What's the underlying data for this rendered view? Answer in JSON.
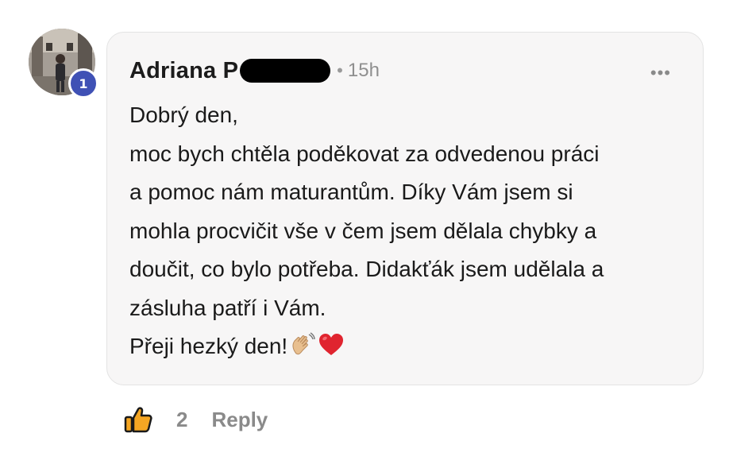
{
  "comment": {
    "author": "Adriana P",
    "separator": "•",
    "time": "15h",
    "more_label": "•••",
    "body_lines": [
      "Dobrý den,",
      "moc bych chtěla poděkovat za odvedenou práci",
      "a pomoc nám maturantům. Díky Vám jsem si",
      "mohla procvičit vše v čem jsem dělala chybky a",
      "doučit, co bylo potřeba. Didakťák jsem udělala a",
      "zásluha patří i Vám.",
      "Přeji hezký den!"
    ],
    "emojis": [
      "waving-hand-icon",
      "red-heart-icon"
    ]
  },
  "avatar": {
    "badge": "1",
    "badge_color": "#3f51b5"
  },
  "footer": {
    "like_count": "2",
    "reply_label": "Reply"
  },
  "colors": {
    "bubble_bg": "#f7f6f6",
    "text": "#1a1a1a",
    "muted": "#8a8a8a",
    "like": "#f5a623",
    "heart": "#e0242f"
  }
}
